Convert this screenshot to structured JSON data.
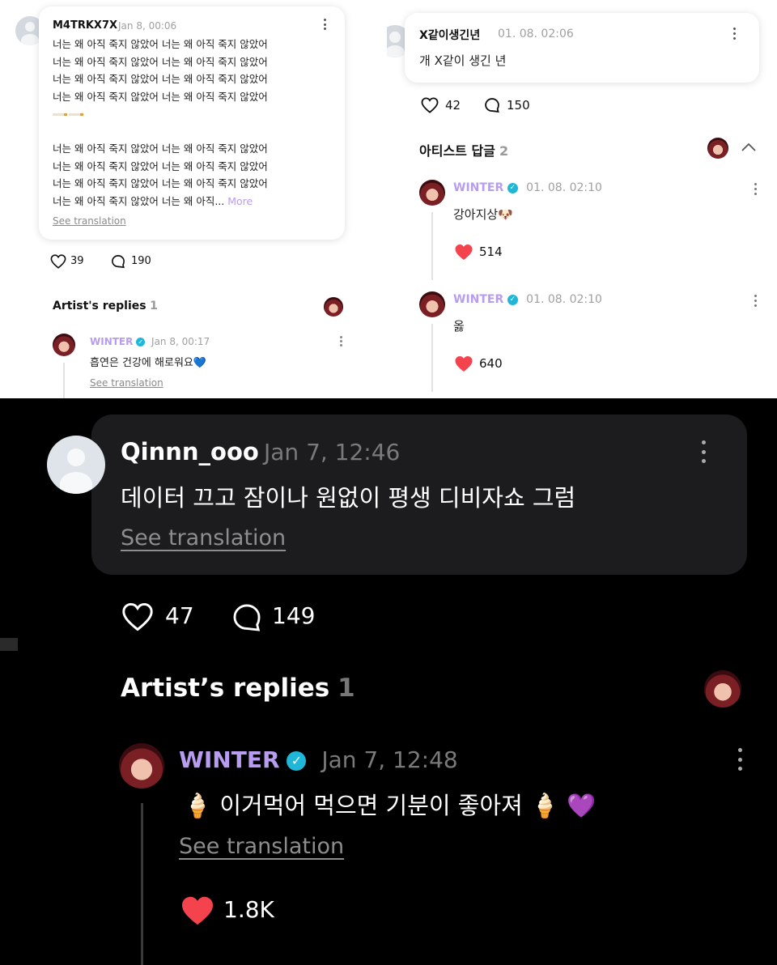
{
  "panel_top_left": {
    "comment": {
      "username": "M4TRKX7X",
      "time": "Jan 8, 00:06",
      "lines": [
        "너는 왜 아직 죽지 않았어 너는 왜 아직 죽지 않았어",
        "너는 왜 아직 죽지 않았어 너는 왜 아직 죽지 않았어",
        "너는 왜 아직 죽지 않았어 너는 왜 아직 죽지 않았어",
        "너는 왜 아직 죽지 않았어 너는 왜 아직 죽지 않았어",
        "",
        "너는 왜 아직 죽지 않았어 너는 왜 아직 죽지 않았어",
        "너는 왜 아직 죽지 않았어 너는 왜 아직 죽지 않았어",
        "너는 왜 아직 죽지 않았어 너는 왜 아직 죽지 않았어"
      ],
      "last_line": "너는 왜 아직 죽지 않았어 너는 왜 아직...",
      "more": "More",
      "see_translation": "See translation"
    },
    "likes": "39",
    "replies": "190",
    "artist_replies_label": "Artist's replies",
    "artist_replies_count": "1",
    "reply": {
      "username": "WINTER",
      "time": "Jan 8, 00:17",
      "text": "흡연은 건강에 해로워요",
      "emoji": "💙",
      "see_translation": "See translation"
    }
  },
  "panel_top_right": {
    "comment": {
      "username": "X같이생긴년",
      "time": "01. 08. 02:06",
      "text": "개 X같이 생긴 년"
    },
    "likes": "42",
    "replies": "150",
    "artist_replies_label": "아티스트 답글",
    "artist_replies_count": "2",
    "replies_list": [
      {
        "username": "WINTER",
        "time": "01. 08. 02:10",
        "text": "강아지상",
        "emoji": "🐶",
        "likes": "514"
      },
      {
        "username": "WINTER",
        "time": "01. 08. 02:10",
        "text": "옳",
        "emoji": "",
        "likes": "640"
      }
    ]
  },
  "panel_bottom": {
    "comment": {
      "username": "Qinnn_ooo",
      "time": "Jan 7, 12:46",
      "text": "데이터 끄고 잠이나 원없이 평생 디비자쇼 그럼",
      "see_translation": "See translation"
    },
    "likes": "47",
    "replies": "149",
    "artist_replies_label": "Artist’s replies",
    "artist_replies_count": "1",
    "reply": {
      "username": "WINTER",
      "time": "Jan 7, 12:48",
      "emoji_left": "🍦",
      "text": "이거먹어 먹으면 기분이 좋아져",
      "emoji_right": "🍦",
      "emoji_heart": "💜",
      "see_translation": "See translation",
      "likes": "1.8K"
    }
  },
  "colors": {
    "artist_name": "#b89cf0",
    "verified": "#1fb7d8",
    "heart": "#f4434d",
    "dark_bubble": "#1c1c1e"
  }
}
